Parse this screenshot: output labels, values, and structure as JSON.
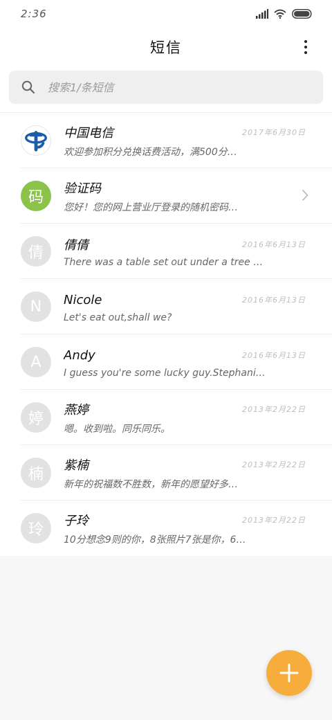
{
  "status_bar": {
    "time": "2:36"
  },
  "header": {
    "title": "短信"
  },
  "search": {
    "placeholder": "搜索1/条短信"
  },
  "conversations": [
    {
      "name": "中国电信",
      "date": "2017年6月30日",
      "preview": "欢迎参加积分兑换话费活动，满500分…",
      "avatar_type": "logo",
      "avatar_char": ""
    },
    {
      "name": "验证码",
      "date": "",
      "preview": "您好！您的网上营业厅登录的随机密码…",
      "avatar_type": "green",
      "avatar_char": "码"
    },
    {
      "name": "倩倩",
      "date": "2016年6月13日",
      "preview": "There was a table set out under a tree …",
      "avatar_type": "gray",
      "avatar_char": "倩"
    },
    {
      "name": "Nicole",
      "date": "2016年6月13日",
      "preview": "Let's eat out,shall we?",
      "avatar_type": "gray",
      "avatar_char": "N"
    },
    {
      "name": "Andy",
      "date": "2016年6月13日",
      "preview": "I guess you're some lucky guy.Stephanie…",
      "avatar_type": "gray",
      "avatar_char": "A"
    },
    {
      "name": "燕婷",
      "date": "2013年2月22日",
      "preview": "嗯。收到啦。同乐同乐。",
      "avatar_type": "gray",
      "avatar_char": "婷"
    },
    {
      "name": "紫楠",
      "date": "2013年2月22日",
      "preview": "新年的祝福数不胜数，新年的愿望好多…",
      "avatar_type": "gray",
      "avatar_char": "楠"
    },
    {
      "name": "子玲",
      "date": "2013年2月22日",
      "preview": "10分想念9则的你，8张照片7张是你，6…",
      "avatar_type": "gray",
      "avatar_char": "玲"
    }
  ],
  "colors": {
    "fab": "#f6ad3c",
    "avatar_gray": "#e2e2e2",
    "avatar_green": "#8bc34a",
    "logo_blue": "#1a5ea8"
  },
  "icons": {
    "search": "search-icon",
    "more": "more-vertical-icon",
    "chevron": "chevron-right-icon",
    "fab": "plus-icon"
  }
}
